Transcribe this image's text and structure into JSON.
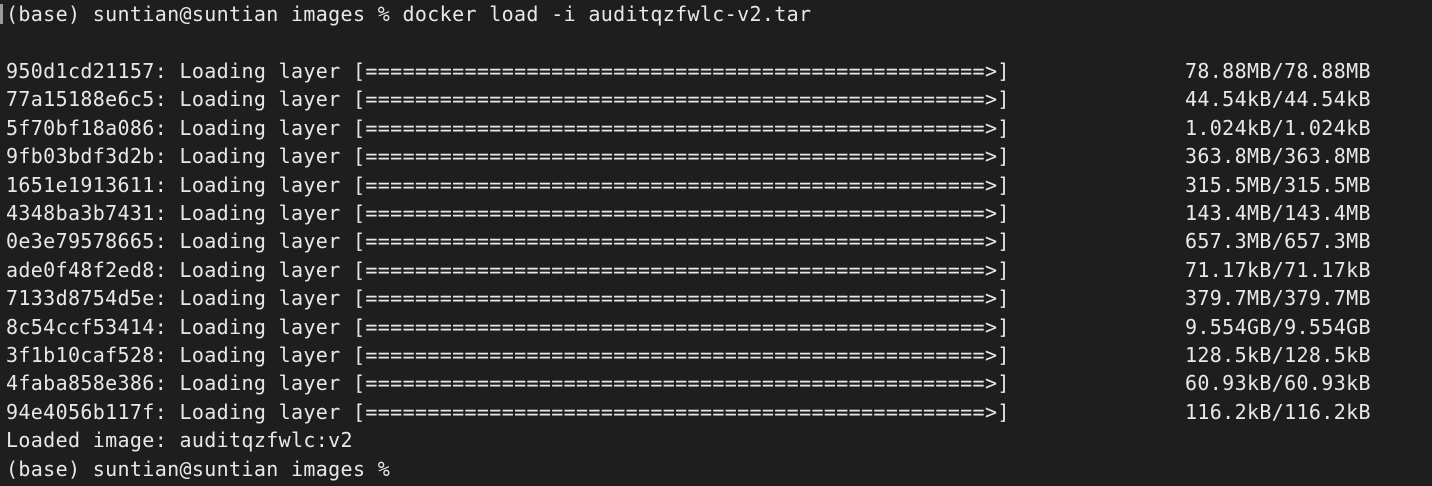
{
  "terminal": {
    "command_line": "(base) suntian@suntian images % docker load -i auditqzfwlc-v2.tar",
    "layers": [
      {
        "id": "950d1cd21157",
        "status": "Loading layer",
        "bar": "[==================================================>]",
        "size": "78.88MB/78.88MB"
      },
      {
        "id": "77a15188e6c5",
        "status": "Loading layer",
        "bar": "[==================================================>]",
        "size": "44.54kB/44.54kB"
      },
      {
        "id": "5f70bf18a086",
        "status": "Loading layer",
        "bar": "[==================================================>]",
        "size": "1.024kB/1.024kB"
      },
      {
        "id": "9fb03bdf3d2b",
        "status": "Loading layer",
        "bar": "[==================================================>]",
        "size": "363.8MB/363.8MB"
      },
      {
        "id": "1651e1913611",
        "status": "Loading layer",
        "bar": "[==================================================>]",
        "size": "315.5MB/315.5MB"
      },
      {
        "id": "4348ba3b7431",
        "status": "Loading layer",
        "bar": "[==================================================>]",
        "size": "143.4MB/143.4MB"
      },
      {
        "id": "0e3e79578665",
        "status": "Loading layer",
        "bar": "[==================================================>]",
        "size": "657.3MB/657.3MB"
      },
      {
        "id": "ade0f48f2ed8",
        "status": "Loading layer",
        "bar": "[==================================================>]",
        "size": "71.17kB/71.17kB"
      },
      {
        "id": "7133d8754d5e",
        "status": "Loading layer",
        "bar": "[==================================================>]",
        "size": "379.7MB/379.7MB"
      },
      {
        "id": "8c54ccf53414",
        "status": "Loading layer",
        "bar": "[==================================================>]",
        "size": "9.554GB/9.554GB"
      },
      {
        "id": "3f1b10caf528",
        "status": "Loading layer",
        "bar": "[==================================================>]",
        "size": "128.5kB/128.5kB"
      },
      {
        "id": "4faba858e386",
        "status": "Loading layer",
        "bar": "[==================================================>]",
        "size": "60.93kB/60.93kB"
      },
      {
        "id": "94e4056b117f",
        "status": "Loading layer",
        "bar": "[==================================================>]",
        "size": "116.2kB/116.2kB"
      }
    ],
    "loaded_line": "Loaded image: auditqzfwlc:v2",
    "prompt_line": "(base) suntian@suntian images %"
  }
}
